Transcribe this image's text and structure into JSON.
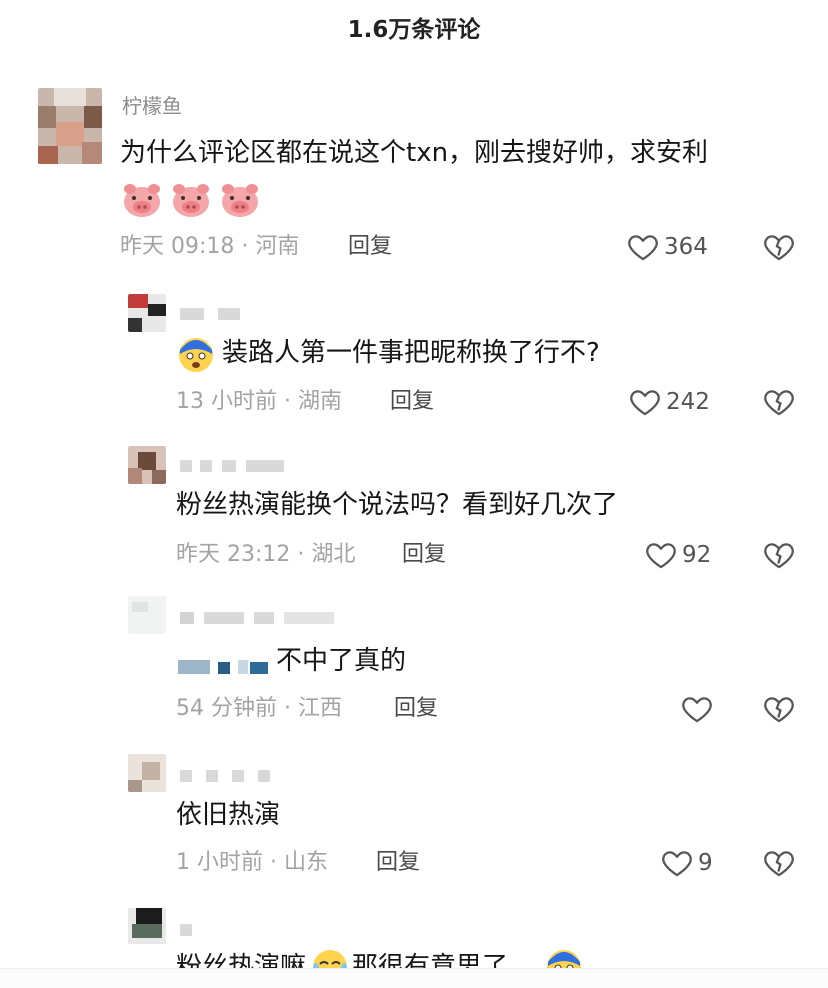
{
  "header": {
    "title": "1.6万条评论"
  },
  "comments": [
    {
      "username": "柠檬鱼",
      "text": "为什么评论区都在说这个txn，刚去搜好帅，求安利",
      "time_location": "昨天 09:18 · 河南",
      "reply_label": "回复",
      "likes": "364"
    },
    {
      "username": "",
      "text": "装路人第一件事把昵称换了行不?",
      "time_location": "13 小时前 · 湖南",
      "reply_label": "回复",
      "likes": "242"
    },
    {
      "username": "",
      "text": "粉丝热演能换个说法吗？看到好几次了",
      "time_location": "昨天 23:12 · 湖北",
      "reply_label": "回复",
      "likes": "92"
    },
    {
      "username": "",
      "text": "不中了真的",
      "time_location": "54 分钟前 · 江西",
      "reply_label": "回复",
      "likes": ""
    },
    {
      "username": "",
      "text": "依旧热演",
      "time_location": "1 小时前 · 山东",
      "reply_label": "回复",
      "likes": "9"
    },
    {
      "username": "",
      "text_part1": "粉丝热演嘛",
      "text_part2": "那很有意思了"
    }
  ],
  "icons": {
    "like": "heart-outline-icon",
    "dislike": "broken-heart-icon",
    "emoji_pig": "pig-face-emoji",
    "emoji_shocked": "shocked-face-emoji",
    "emoji_laugh": "laughing-crying-emoji"
  },
  "colors": {
    "meta_gray": "#a3a3a3",
    "text_dark": "#161616",
    "icon_gray": "#555555",
    "pig_pink": "#f4a6a8"
  }
}
